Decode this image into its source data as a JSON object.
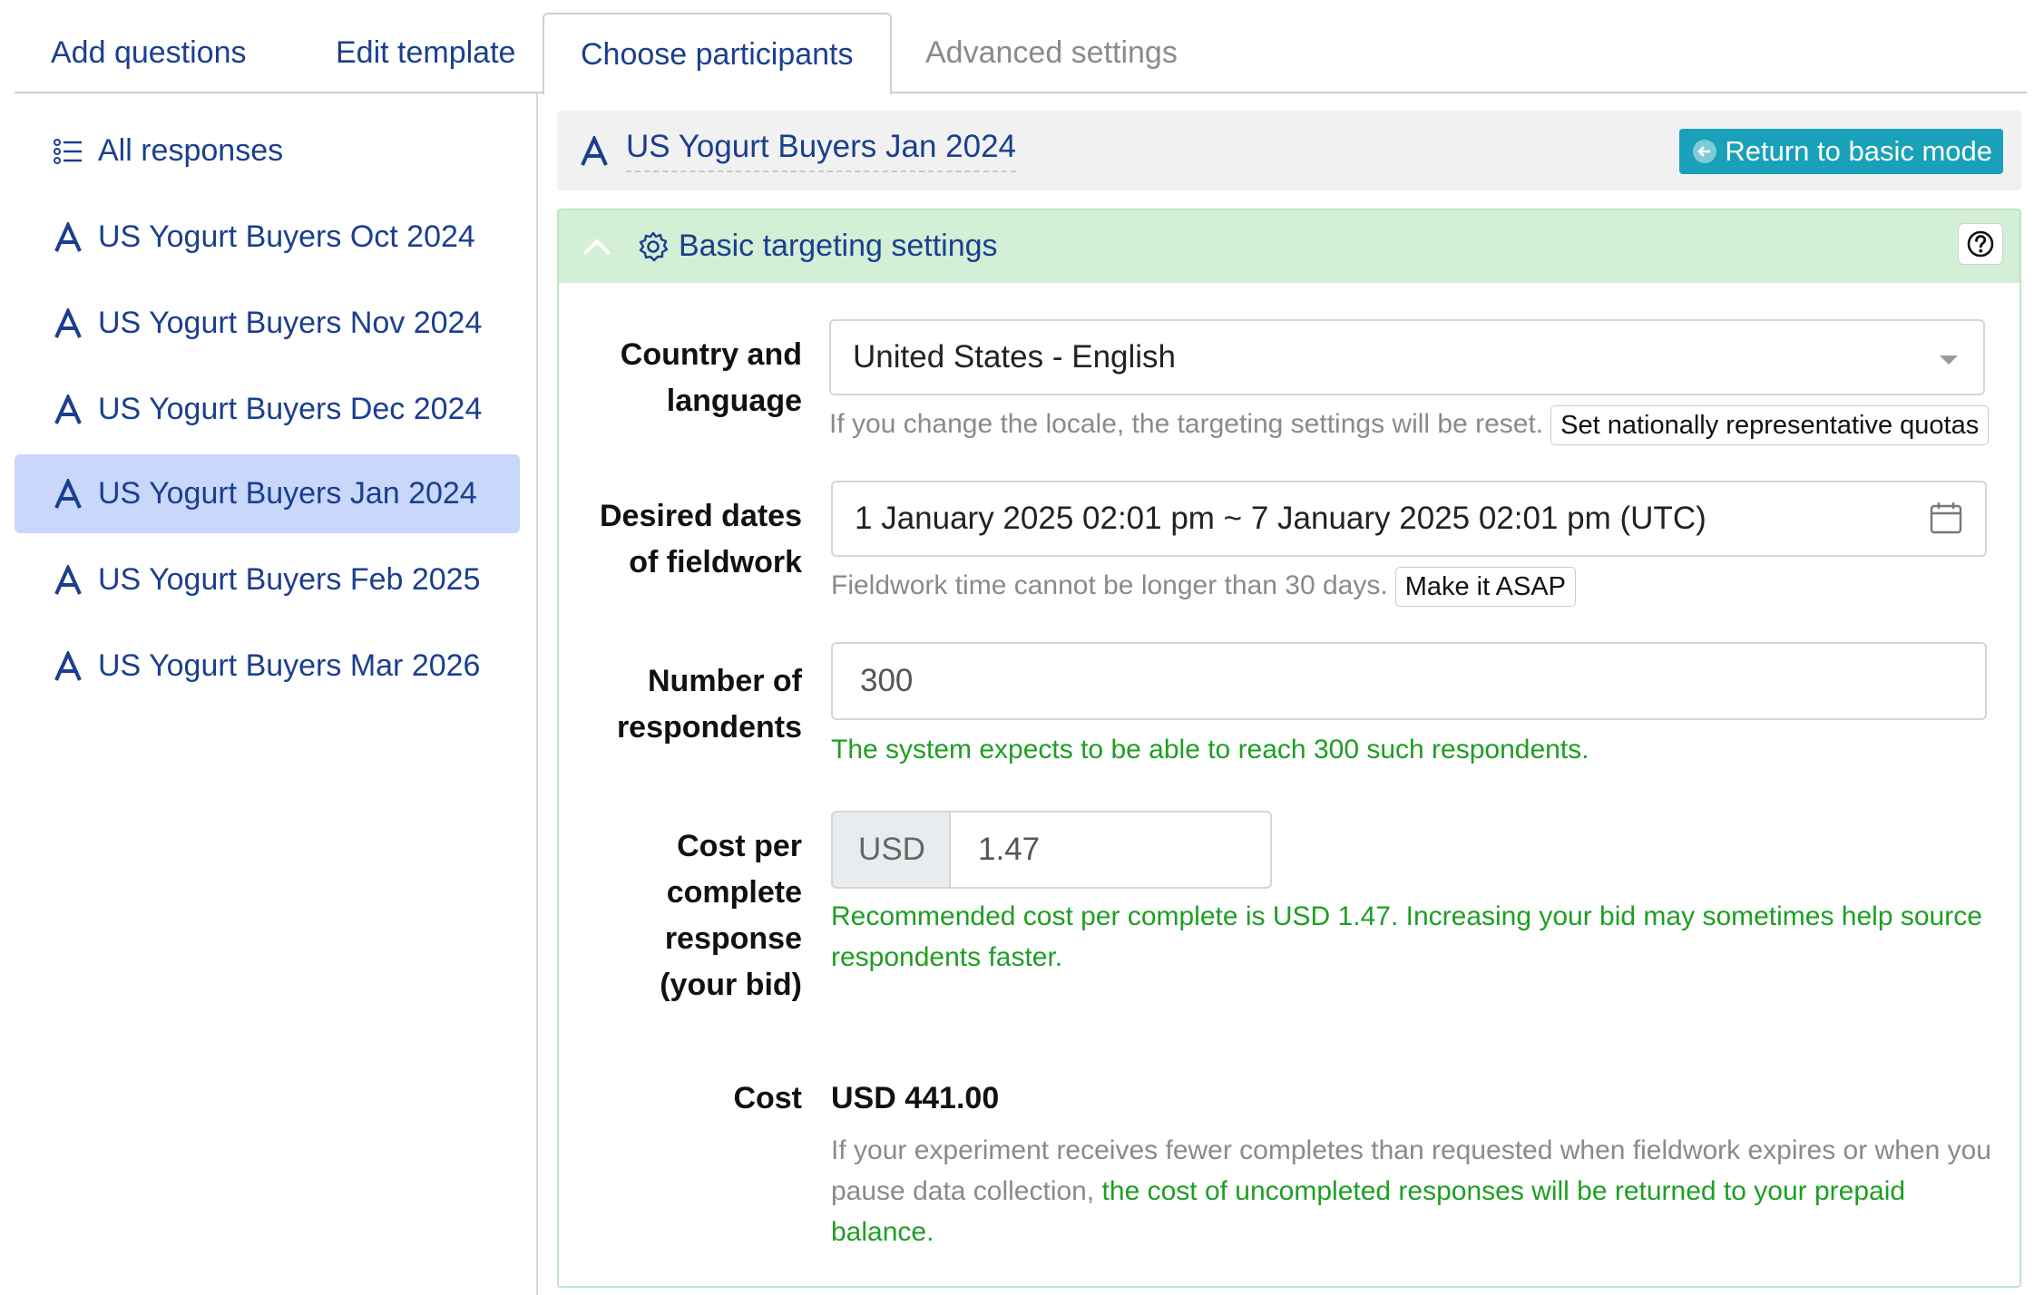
{
  "tabs": [
    {
      "label": "Add questions"
    },
    {
      "label": "Edit template"
    },
    {
      "label": "Choose participants"
    },
    {
      "label": "Advanced settings"
    }
  ],
  "sidebar": {
    "all_responses": "All responses",
    "items": [
      {
        "label": "US Yogurt Buyers Oct 2024"
      },
      {
        "label": "US Yogurt Buyers Nov 2024"
      },
      {
        "label": "US Yogurt Buyers Dec 2024"
      },
      {
        "label": "US Yogurt Buyers Jan 2024"
      },
      {
        "label": "US Yogurt Buyers Feb 2025"
      },
      {
        "label": "US Yogurt Buyers Mar 2026"
      }
    ]
  },
  "header": {
    "survey_title": "US Yogurt Buyers Jan 2024",
    "return_button": "Return to basic mode"
  },
  "panel": {
    "title": "Basic targeting settings",
    "country": {
      "label_line1": "Country and",
      "label_line2": "language",
      "value": "United States - English",
      "hint": "If you change the locale, the targeting settings will be reset.",
      "button": "Set nationally representative quotas"
    },
    "dates": {
      "label_line1": "Desired dates",
      "label_line2": "of fieldwork",
      "value": "1 January 2025 02:01 pm ~ 7 January 2025 02:01 pm (UTC)",
      "hint": "Fieldwork time cannot be longer than 30 days.",
      "button": "Make it ASAP"
    },
    "respondents": {
      "label_line1": "Number of",
      "label_line2": "respondents",
      "value": "300",
      "hint": "The system expects to be able to reach 300 such respondents."
    },
    "bid": {
      "label_line1": "Cost per",
      "label_line2": "complete",
      "label_line3": "response",
      "label_line4": "(your bid)",
      "currency": "USD",
      "value": "1.47",
      "hint": "Recommended cost per complete is USD 1.47. Increasing your bid may sometimes help source respondents faster."
    },
    "cost": {
      "label": "Cost",
      "value": "USD 441.00",
      "note_gray": "If your experiment receives fewer completes than requested when fieldwork expires or when you pause data collection,",
      "note_green": "the cost of uncompleted responses will be returned to your prepaid balance."
    }
  },
  "colors": {
    "link_blue": "#1b3f8f",
    "selected_bg": "#c8d7fa",
    "panel_head_green": "#d3efd5",
    "success_green": "#1e9e23",
    "button_teal": "#18a1b8"
  },
  "icons": [
    "list-icon",
    "survey-a-icon",
    "arrow-left-circle-icon",
    "chevron-up-icon",
    "gear-icon",
    "help-icon",
    "caret-down-icon",
    "calendar-icon"
  ]
}
